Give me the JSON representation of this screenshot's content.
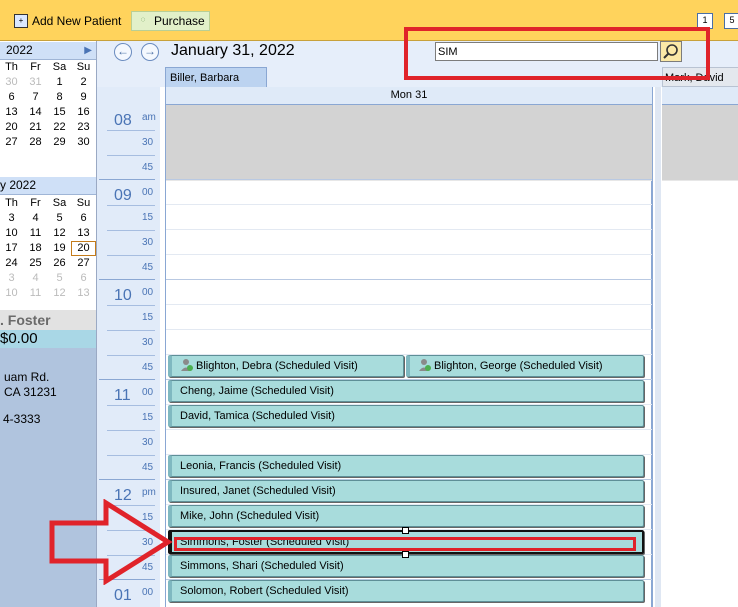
{
  "toolbar": {
    "add_new_patient": "Add New Patient",
    "purchase": "Purchase",
    "right_badge_1": "1",
    "right_badge_2": "5"
  },
  "mini_calendar_1": {
    "header": "2022",
    "days_header": [
      "Th",
      "Fr",
      "Sa",
      "Su"
    ],
    "weeks": [
      [
        "30",
        "31",
        "1",
        "2"
      ],
      [
        "6",
        "7",
        "8",
        "9"
      ],
      [
        "13",
        "14",
        "15",
        "16"
      ],
      [
        "20",
        "21",
        "22",
        "23"
      ],
      [
        "27",
        "28",
        "29",
        "30"
      ]
    ]
  },
  "mini_calendar_2": {
    "header": "y 2022",
    "days_header": [
      "Th",
      "Fr",
      "Sa",
      "Su"
    ],
    "weeks": [
      [
        "3",
        "4",
        "5",
        "6"
      ],
      [
        "10",
        "11",
        "12",
        "13"
      ],
      [
        "17",
        "18",
        "19",
        "20"
      ],
      [
        "24",
        "25",
        "26",
        "27"
      ],
      [
        "3",
        "4",
        "5",
        "6"
      ],
      [
        "10",
        "11",
        "12",
        "13"
      ]
    ],
    "today": "20"
  },
  "patient": {
    "name": ". Foster",
    "balance": "$0.00",
    "address_line1": "uam Rd.",
    "address_line2": "CA 31231",
    "phone": "4-3333"
  },
  "scheduler": {
    "date": "January 31, 2022",
    "search_value": "SIM",
    "provider_tab": "Biller, Barbara",
    "provider_tab_2": "Mark, David",
    "day_header": "Mon 31"
  },
  "ruler": {
    "hours": [
      {
        "hour": "08",
        "suffix": "am"
      },
      {
        "hour": "09",
        "suffix": "00"
      },
      {
        "hour": "10",
        "suffix": "00"
      },
      {
        "hour": "11",
        "suffix": "00"
      },
      {
        "hour": "12",
        "suffix": "pm"
      },
      {
        "hour": "01",
        "suffix": "00"
      }
    ],
    "minutes": [
      "15",
      "30",
      "45"
    ]
  },
  "appointments": [
    {
      "label": "Blighton, Debra (Scheduled Visit)",
      "icon": "person-icon"
    },
    {
      "label": "Blighton, George (Scheduled Visit)",
      "icon": "person-icon"
    },
    {
      "label": "Cheng, Jaime (Scheduled Visit)"
    },
    {
      "label": "David, Tamica (Scheduled Visit)"
    },
    {
      "label": "Leonia, Francis (Scheduled Visit)"
    },
    {
      "label": "Insured, Janet (Scheduled Visit)"
    },
    {
      "label": "Mike, John (Scheduled Visit)"
    },
    {
      "label": "Simmons, Foster (Scheduled Visit)",
      "selected": true
    },
    {
      "label": "Simmons, Shari (Scheduled Visit)"
    },
    {
      "label": "Solomon, Robert (Scheduled Visit)"
    }
  ],
  "colors": {
    "toolbar": "#ffd35c",
    "appointment": "#a8dcdc",
    "highlight": "#e0232a",
    "ruler": "#e1ebf9"
  }
}
